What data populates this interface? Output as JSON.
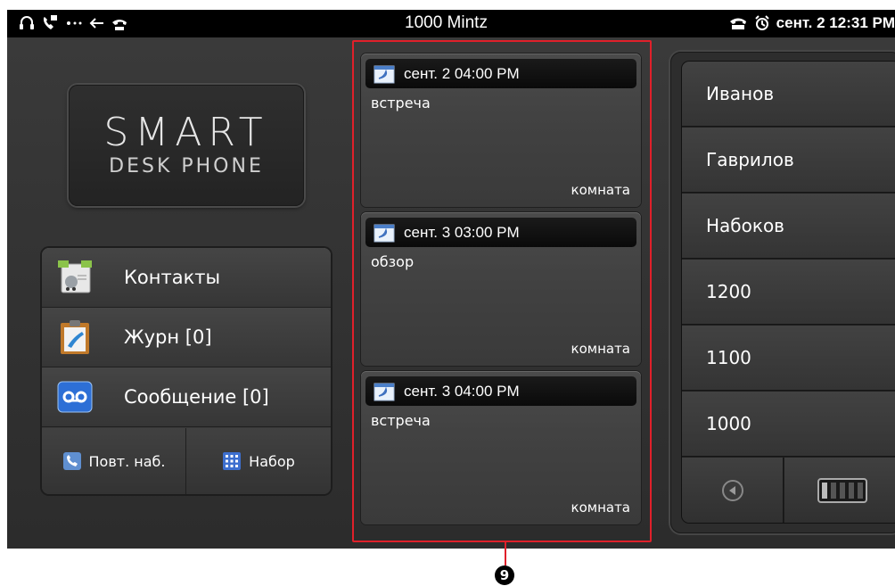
{
  "status_bar": {
    "title": "1000  Mintz",
    "datetime": "сент. 2 12:31 PM",
    "icons": [
      "headset-icon",
      "voicemail-phone-icon",
      "dots-icon",
      "back-arrow-icon",
      "phone-icon"
    ],
    "right_icons": [
      "handset-icon",
      "alarm-icon"
    ]
  },
  "logo": {
    "line1": "SMART",
    "line2": "DESK PHONE"
  },
  "menu": {
    "items": [
      {
        "label": "Контакты",
        "icon": "contacts-icon"
      },
      {
        "label": "Журн [0]",
        "icon": "call-log-icon"
      },
      {
        "label": "Сообщение [0]",
        "icon": "voicemail-icon"
      }
    ],
    "redial_label": "Повт. наб.",
    "dialpad_label": "Набор"
  },
  "agenda": {
    "events": [
      {
        "time": "сент. 2 04:00 PM",
        "title": "встреча",
        "room": "комната"
      },
      {
        "time": "сент. 3 03:00 PM",
        "title": "обзор",
        "room": "комната"
      },
      {
        "time": "сент. 3 04:00 PM",
        "title": "встреча",
        "room": "комната"
      }
    ],
    "callout": "9"
  },
  "speed_dial": {
    "items": [
      "Иванов",
      "Гаврилов",
      "Набоков",
      "1200",
      "1100",
      "1000"
    ]
  },
  "colors": {
    "highlight": "#e0202a",
    "background": "#343434",
    "status_bar": "#000000",
    "voicemail_blue": "#2d6fd6"
  }
}
